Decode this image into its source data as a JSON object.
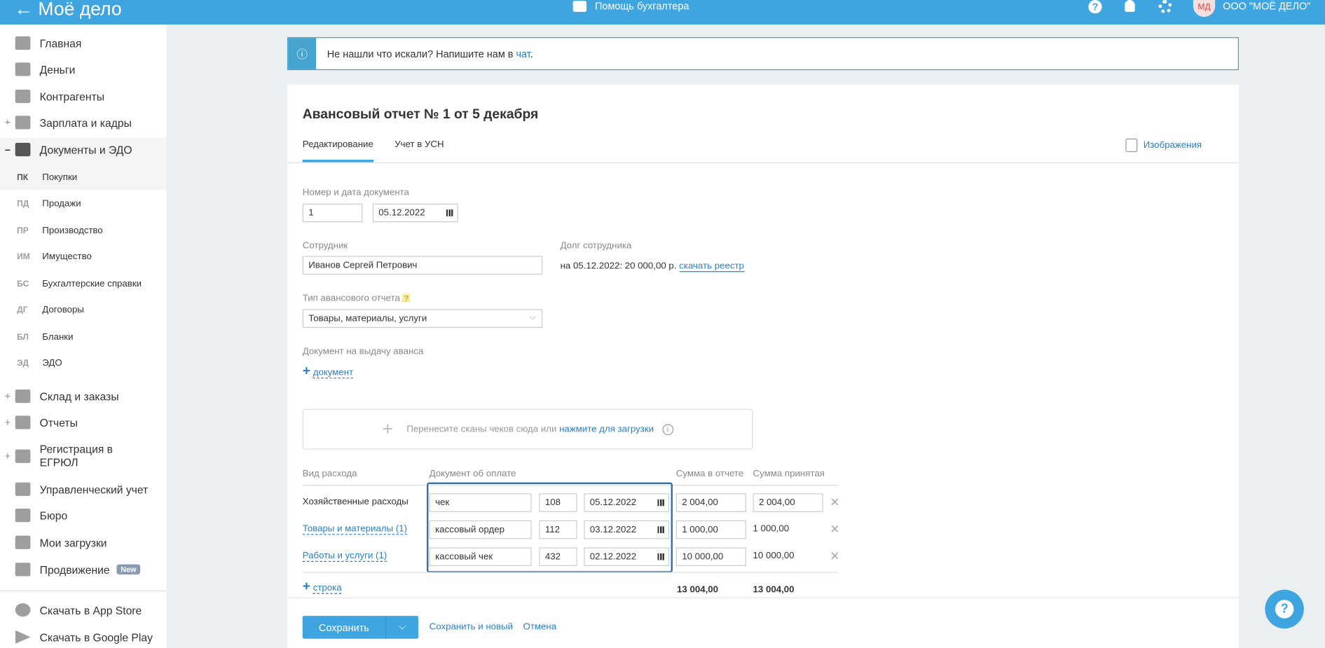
{
  "header": {
    "logo": "Моё дело",
    "back": "←",
    "help": "Помощь бухгалтера",
    "avatar": "МД",
    "org": "ООО \"МОЁ ДЕЛО\""
  },
  "sidebar": {
    "items": [
      {
        "label": "Главная",
        "expand": ""
      },
      {
        "label": "Деньги",
        "expand": ""
      },
      {
        "label": "Контрагенты",
        "expand": ""
      },
      {
        "label": "Зарплата и кадры",
        "expand": "+"
      },
      {
        "label": "Документы и ЭДО",
        "expand": "–"
      }
    ],
    "sub": [
      {
        "abbr": "ПК",
        "label": "Покупки"
      },
      {
        "abbr": "ПД",
        "label": "Продажи"
      },
      {
        "abbr": "ПР",
        "label": "Производство"
      },
      {
        "abbr": "ИМ",
        "label": "Имущество"
      },
      {
        "abbr": "БС",
        "label": "Бухгалтерские справки"
      },
      {
        "abbr": "ДГ",
        "label": "Договоры"
      },
      {
        "abbr": "БЛ",
        "label": "Бланки"
      },
      {
        "abbr": "ЭД",
        "label": "ЭДО"
      }
    ],
    "items2": [
      {
        "label": "Склад и заказы",
        "expand": "+"
      },
      {
        "label": "Отчеты",
        "expand": "+"
      },
      {
        "label": "Регистрация в ЕГРЮЛ",
        "expand": "+"
      },
      {
        "label": "Управленческий учет",
        "expand": ""
      },
      {
        "label": "Бюро",
        "expand": ""
      },
      {
        "label": "Мои загрузки",
        "expand": ""
      },
      {
        "label": "Продвижение",
        "expand": "",
        "badge": "New"
      }
    ],
    "stores": [
      {
        "label": "Скачать в App Store"
      },
      {
        "label": "Скачать в Google Play"
      }
    ]
  },
  "info": {
    "text": "Не нашли что искали? Напишите нам в ",
    "link": "чат",
    "end": "."
  },
  "doc": {
    "title": "Авансовый отчет № 1 от 5 декабря",
    "tabs": [
      "Редактирование",
      "Учет в УСН"
    ],
    "images": "Изображения",
    "num_label": "Номер и дата документа",
    "num": "1",
    "date": "05.12.2022",
    "emp_label": "Сотрудник",
    "emp": "Иванов Сергей Петрович",
    "debt_label": "Долг сотрудника",
    "debt": "на 05.12.2022: 20 000,00 р.",
    "debt_link": "скачать реестр",
    "type_label": "Тип авансового отчета",
    "type_help": "?",
    "type": "Товары, материалы, услуги",
    "adv_label": "Документ на выдачу аванса",
    "adv_add": "документ",
    "drop_text": "Перенесите сканы чеков сюда или ",
    "drop_link": "нажмите для загрузки"
  },
  "table": {
    "headers": [
      "Вид расхода",
      "Документ об оплате",
      "Сумма в отчете",
      "Сумма принятая"
    ],
    "rows": [
      {
        "kind": "Хозяйственные расходы",
        "link": false,
        "doc": "чек",
        "num": "108",
        "date": "05.12.2022",
        "sum": "2 004,00",
        "accepted": "2 004,00",
        "accepted_input": true
      },
      {
        "kind": "Товары и материалы (1)",
        "link": true,
        "doc": "кассовый ордер",
        "num": "112",
        "date": "03.12.2022",
        "sum": "1 000,00",
        "accepted": "1 000,00",
        "accepted_input": false
      },
      {
        "kind": "Работы и услуги (1)",
        "link": true,
        "doc": "кассовый чек",
        "num": "432",
        "date": "02.12.2022",
        "sum": "10 000,00",
        "accepted": "10 000,00",
        "accepted_input": false
      }
    ],
    "add_row": "строка",
    "total_sum": "13 004,00",
    "total_accepted": "13 004,00"
  },
  "footer": {
    "save": "Сохранить",
    "save_new": "Сохранить и новый",
    "cancel": "Отмена"
  },
  "colors": {
    "header": "#3ea5e0",
    "link": "#2a7fc1",
    "focus": "#2f6fb5"
  }
}
